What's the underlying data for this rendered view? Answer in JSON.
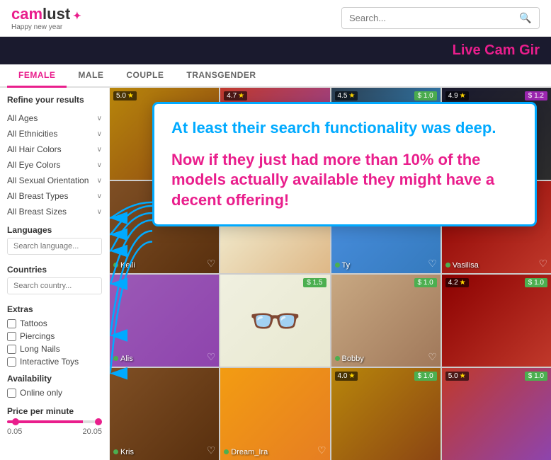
{
  "header": {
    "logo_main": "camlust",
    "logo_star": "✦",
    "logo_subtitle": "Happy new year",
    "search_placeholder": "Search...",
    "search_icon": "🔍",
    "banner_text": "Live Cam Gir"
  },
  "nav": {
    "tabs": [
      {
        "label": "FEMALE",
        "active": true
      },
      {
        "label": "MALE",
        "active": false
      },
      {
        "label": "COUPLE",
        "active": false
      },
      {
        "label": "TRANSGENDER",
        "active": false
      }
    ]
  },
  "sidebar": {
    "refine_title": "Refine your results",
    "filters": [
      {
        "label": "All Ages",
        "has_arrow": true
      },
      {
        "label": "All Ethnicities",
        "has_arrow": true
      },
      {
        "label": "All Hair Colors",
        "has_arrow": true
      },
      {
        "label": "All Eye Colors",
        "has_arrow": true
      },
      {
        "label": "All Sexual Orientation",
        "has_arrow": true
      },
      {
        "label": "All Breast Types",
        "has_arrow": true
      },
      {
        "label": "All Breast Sizes",
        "has_arrow": true
      }
    ],
    "languages_label": "Languages",
    "search_language_placeholder": "Search language...",
    "countries_label": "Countries",
    "search_country_placeholder": "Search country...",
    "extras_label": "Extras",
    "extras_items": [
      {
        "label": "Tattoos"
      },
      {
        "label": "Piercings"
      },
      {
        "label": "Long Nails"
      },
      {
        "label": "Interactive Toys"
      }
    ],
    "availability_label": "Availability",
    "availability_items": [
      {
        "label": "Online only"
      }
    ],
    "price_label": "Price per minute",
    "price_min": "0.05",
    "price_max": "20.05"
  },
  "models": [
    {
      "name": "",
      "rating": "5.0",
      "price": "",
      "color_class": "mc1",
      "has_heart": false,
      "dot": false,
      "badge_pos": "top-left"
    },
    {
      "name": "",
      "rating": "4.7",
      "price": "",
      "color_class": "mc2",
      "has_heart": false,
      "dot": false
    },
    {
      "name": "",
      "rating": "4.5",
      "price": "$ 1.0",
      "color_class": "mc3",
      "has_heart": false,
      "dot": false
    },
    {
      "name": "",
      "rating": "4.9",
      "price": "$ 1.2",
      "color_class": "mc4",
      "has_heart": false,
      "dot": false
    },
    {
      "name": "Kelli",
      "rating": "",
      "price": "",
      "color_class": "mc5",
      "has_heart": true,
      "dot": true
    },
    {
      "name": "",
      "rating": "",
      "price": "",
      "color_class": "mc6",
      "has_heart": false,
      "dot": false
    },
    {
      "name": "Ty",
      "rating": "",
      "price": "",
      "color_class": "mc7",
      "has_heart": true,
      "dot": true
    },
    {
      "name": "Vasilisa",
      "rating": "",
      "price": "",
      "color_class": "mc8",
      "has_heart": true,
      "dot": true
    },
    {
      "name": "Alis",
      "rating": "",
      "price": "",
      "color_class": "mc9",
      "has_heart": true,
      "dot": true
    },
    {
      "name": "",
      "rating": "",
      "price": "$ 1.5",
      "color_class": "mc10",
      "has_heart": false,
      "dot": false
    },
    {
      "name": "Bobby",
      "rating": "",
      "price": "$ 1.0",
      "color_class": "mc11",
      "has_heart": true,
      "dot": true
    },
    {
      "name": "Kris",
      "rating": "",
      "price": "",
      "color_class": "mc5",
      "has_heart": true,
      "dot": true
    },
    {
      "name": "Dream_Ira",
      "rating": "",
      "price": "",
      "color_class": "mc12",
      "has_heart": true,
      "dot": true
    },
    {
      "name": "",
      "rating": "4.0",
      "price": "$ 1.0",
      "color_class": "mc1",
      "has_heart": false,
      "dot": false
    },
    {
      "name": "",
      "rating": "",
      "price": "$ 1.0",
      "color_class": "mc2",
      "has_heart": false,
      "dot": false
    },
    {
      "name": "",
      "rating": "",
      "price": "$ 1.0",
      "color_class": "mc3",
      "has_heart": false,
      "dot": false
    },
    {
      "name": "",
      "rating": "5.0",
      "price": "$ 1.0",
      "color_class": "mc4",
      "has_heart": false,
      "dot": false
    },
    {
      "name": "",
      "rating": "",
      "price": "$ 1.0",
      "color_class": "mc7",
      "has_heart": false,
      "dot": false
    }
  ],
  "overlay": {
    "text_blue": "At least their search functionality was deep.",
    "text_red": "Now if they just had more than 10% of the models actually available they might have a decent offering!",
    "arrow_targets": [
      "All Ethnicities",
      "All Hair Colors",
      "Colors",
      "Breast Types",
      "Search language",
      "Search"
    ]
  },
  "icons": {
    "search": "🔍",
    "heart": "♡",
    "star": "★",
    "chevron_down": "∨",
    "arrow_left": "←"
  }
}
